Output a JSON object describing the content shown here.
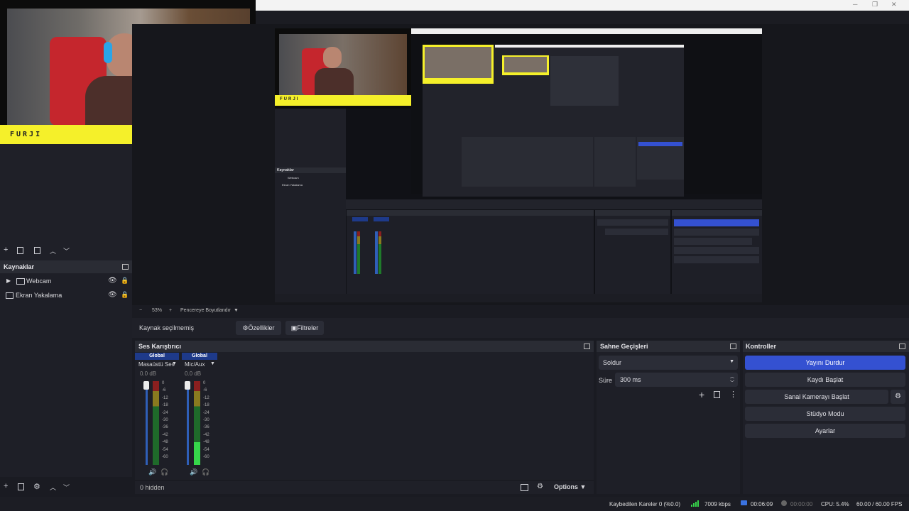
{
  "window": {
    "minimize": "─",
    "restore": "❐",
    "close": "✕"
  },
  "webcam_overlay": {
    "brand": "FURJI",
    "accent": "#f5f02a"
  },
  "scenes": {
    "toolbar": [
      "+",
      "🗑",
      "▣",
      "▲",
      "▼"
    ]
  },
  "sources": {
    "title": "Kaynaklar",
    "items": [
      {
        "label": "Webcam",
        "type": "folder"
      },
      {
        "label": "Ekran Yakalama",
        "type": "display"
      }
    ]
  },
  "preview": {
    "zoom_minus": "−",
    "zoom": "53%",
    "zoom_plus": "+",
    "fit_label": "Pencereye Boyutlandır",
    "nested_title": "Kaynaklar",
    "nested_items": [
      "Webcam",
      "Ekran Yakalama"
    ],
    "nested_brand": "FURJI"
  },
  "context_bar": {
    "no_source": "Kaynak seçilmemiş",
    "properties": "Özellikler",
    "filters": "Filtreler"
  },
  "mixer": {
    "title": "Ses Karıştırıcı",
    "channels": [
      {
        "badge": "Global",
        "name": "Masaüstü Ses",
        "db": "0.0 dB"
      },
      {
        "badge": "Global",
        "name": "Mic/Aux",
        "db": "0.0 dB"
      }
    ],
    "scale": [
      "0",
      "-6",
      "-12",
      "-18",
      "-24",
      "-30",
      "-36",
      "-42",
      "-48",
      "-54",
      "-60"
    ],
    "hidden": "0 hidden",
    "options": "Options"
  },
  "transitions": {
    "title": "Sahne Geçişleri",
    "selected": "Soldur",
    "duration_label": "Süre",
    "duration_value": "300 ms"
  },
  "controls": {
    "title": "Kontroller",
    "stop_stream": "Yayını Durdur",
    "start_record": "Kaydı Başlat",
    "virtual_cam": "Sanal Kamerayı Başlat",
    "studio_mode": "Stüdyo Modu",
    "settings": "Ayarlar",
    "accent": "#3451d1"
  },
  "status": {
    "dropped": "Kaybedilen Kareler 0 (%0.0)",
    "bitrate": "7009 kbps",
    "stream_time": "00:06:09",
    "record_time": "00:00:00",
    "cpu": "CPU: 5.4%",
    "fps": "60.00 / 60.00 FPS"
  }
}
